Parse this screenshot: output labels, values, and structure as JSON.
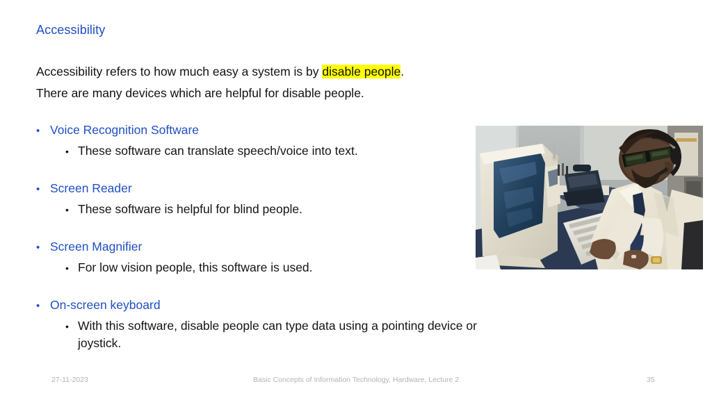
{
  "slide": {
    "title": "Accessibility",
    "intro": {
      "before": "Accessibility refers to how much easy a system is by ",
      "highlight": "disable people",
      "after": ".",
      "line2": "There are many devices which are helpful for disable people.",
      "highlight_color": "#ffff00"
    },
    "bullet_marker": "•",
    "accent_color": "#1f4fc4",
    "groups": [
      {
        "heading": "Voice Recognition Software",
        "detail": "These software can translate speech/voice into text."
      },
      {
        "heading": "Screen Reader",
        "detail": "These software is helpful for blind people."
      },
      {
        "heading": "Screen Magnifier",
        "detail": "For low vision people, this software is used."
      },
      {
        "heading": "On-screen keyboard",
        "detail": "With this software, disable people can type data using a pointing device or joystick."
      }
    ],
    "photo": {
      "alt": "Man wearing dark sunglasses and a headset typing at a desktop computer keyboard in an office cubicle"
    },
    "footer": {
      "date": "27-11-2023",
      "center": "Basic Concepts of Information Technology, Hardware, Lecture 2",
      "page": "35"
    }
  }
}
